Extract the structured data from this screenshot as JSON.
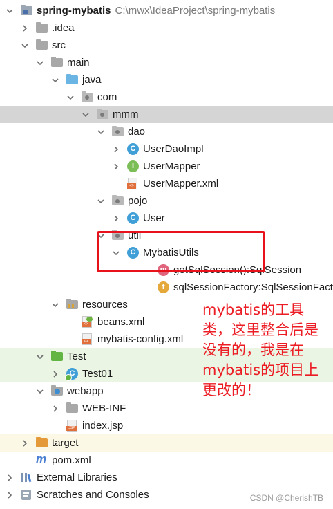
{
  "project": {
    "name": "spring-mybatis",
    "path": "C:\\mwx\\IdeaProject\\spring-mybatis"
  },
  "tree": [
    {
      "label": "spring-mybatis",
      "path": "C:\\mwx\\IdeaProject\\spring-mybatis",
      "depth": 0,
      "chev": "down",
      "icon": "module-folder-icon",
      "kind": "module",
      "bold": true
    },
    {
      "label": ".idea",
      "depth": 1,
      "chev": "right",
      "icon": "folder-icon",
      "kind": "folder"
    },
    {
      "label": "src",
      "depth": 1,
      "chev": "down",
      "icon": "folder-icon",
      "kind": "folder"
    },
    {
      "label": "main",
      "depth": 2,
      "chev": "down",
      "icon": "folder-icon",
      "kind": "folder"
    },
    {
      "label": "java",
      "depth": 3,
      "chev": "down",
      "icon": "source-folder-icon",
      "kind": "src"
    },
    {
      "label": "com",
      "depth": 4,
      "chev": "down",
      "icon": "package-icon",
      "kind": "pkg"
    },
    {
      "label": "mmm",
      "depth": 5,
      "chev": "down",
      "icon": "package-icon",
      "kind": "pkg",
      "selected": true
    },
    {
      "label": "dao",
      "depth": 6,
      "chev": "down",
      "icon": "package-icon",
      "kind": "pkg"
    },
    {
      "label": "UserDaoImpl",
      "depth": 7,
      "chev": "right",
      "icon": "class-icon",
      "kind": "class"
    },
    {
      "label": "UserMapper",
      "depth": 7,
      "chev": "right",
      "icon": "interface-icon",
      "kind": "iface"
    },
    {
      "label": "UserMapper.xml",
      "depth": 7,
      "chev": "none",
      "icon": "xml-file-icon",
      "kind": "xml"
    },
    {
      "label": "pojo",
      "depth": 6,
      "chev": "down",
      "icon": "package-icon",
      "kind": "pkg"
    },
    {
      "label": "User",
      "depth": 7,
      "chev": "right",
      "icon": "class-icon",
      "kind": "class"
    },
    {
      "label": "util",
      "depth": 6,
      "chev": "down",
      "icon": "package-icon",
      "kind": "pkg"
    },
    {
      "label": "MybatisUtils",
      "depth": 7,
      "chev": "down",
      "icon": "class-icon",
      "kind": "class"
    },
    {
      "label": "getSqlSession():SqlSession",
      "depth": 9,
      "chev": "none",
      "icon": "method-icon",
      "kind": "method"
    },
    {
      "label": "sqlSessionFactory:SqlSessionFactory",
      "depth": 9,
      "chev": "none",
      "icon": "field-icon",
      "kind": "field"
    },
    {
      "label": "resources",
      "depth": 3,
      "chev": "down",
      "icon": "resources-folder-icon",
      "kind": "res"
    },
    {
      "label": "beans.xml",
      "depth": 4,
      "chev": "none",
      "icon": "spring-xml-icon",
      "kind": "springxml"
    },
    {
      "label": "mybatis-config.xml",
      "depth": 4,
      "chev": "none",
      "icon": "xml-file-icon",
      "kind": "xml"
    },
    {
      "label": "Test",
      "depth": 2,
      "chev": "down",
      "icon": "test-folder-icon",
      "kind": "test",
      "bg": "green"
    },
    {
      "label": "Test01",
      "depth": 3,
      "chev": "right",
      "icon": "test-class-icon",
      "kind": "testclass",
      "bg": "green"
    },
    {
      "label": "webapp",
      "depth": 2,
      "chev": "down",
      "icon": "web-folder-icon",
      "kind": "web"
    },
    {
      "label": "WEB-INF",
      "depth": 3,
      "chev": "right",
      "icon": "folder-icon",
      "kind": "folder"
    },
    {
      "label": "index.jsp",
      "depth": 3,
      "chev": "none",
      "icon": "jsp-file-icon",
      "kind": "jsp"
    },
    {
      "label": "target",
      "depth": 1,
      "chev": "right",
      "icon": "excluded-folder-icon",
      "kind": "excluded",
      "bg": "yellow"
    },
    {
      "label": "pom.xml",
      "depth": 1,
      "chev": "none",
      "icon": "maven-icon",
      "kind": "maven"
    },
    {
      "label": "External Libraries",
      "depth": 0,
      "chev": "right",
      "icon": "libraries-icon",
      "kind": "libs"
    },
    {
      "label": "Scratches and Consoles",
      "depth": 0,
      "chev": "right",
      "icon": "scratches-icon",
      "kind": "scratch"
    }
  ],
  "annotation": {
    "text": "mybatis的工具类，这里整合后是没有的，我是在mybatis的项目上更改的！",
    "color": "#ec1c24"
  },
  "watermark": "CSDN @CherishTB",
  "colors": {
    "selected_row": "#d5d5d5",
    "test_row": "#eaf5e4",
    "excluded_row": "#fbf8e6",
    "folder": "#a8a8a8",
    "source_folder": "#6ab5e3",
    "class_circle": "#3f9fd6",
    "interface_circle": "#7bbd57",
    "test_folder": "#62b543",
    "excluded_folder": "#e59a3a"
  }
}
